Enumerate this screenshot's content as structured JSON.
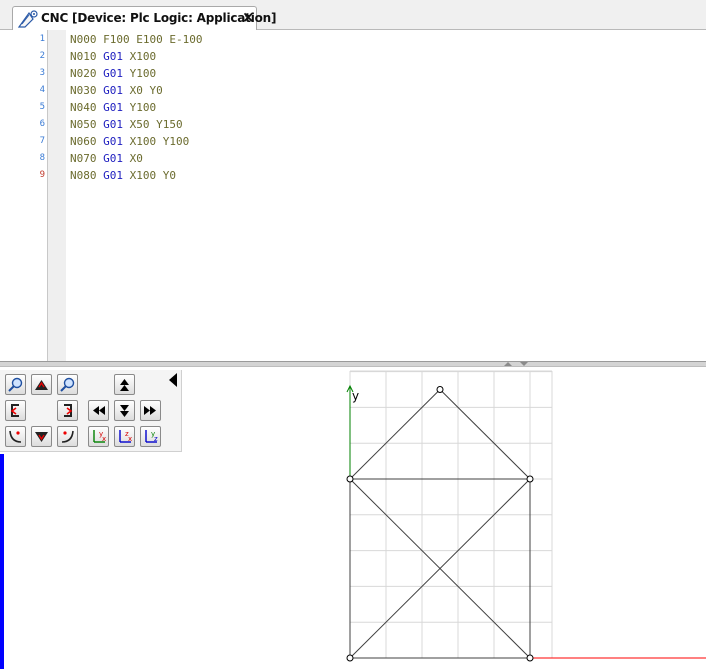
{
  "tab": {
    "title": "CNC [Device: Plc Logic: Application]",
    "close_label": "×",
    "icon": "cnc-gear-icon"
  },
  "editor": {
    "lines": [
      {
        "num": "1",
        "tokens": [
          {
            "t": "N000",
            "c": "n"
          },
          {
            "t": " "
          },
          {
            "t": "F100",
            "c": "v"
          },
          {
            "t": " "
          },
          {
            "t": "E100",
            "c": "v"
          },
          {
            "t": " "
          },
          {
            "t": "E-100",
            "c": "v"
          }
        ]
      },
      {
        "num": "2",
        "tokens": [
          {
            "t": "N010",
            "c": "n"
          },
          {
            "t": " "
          },
          {
            "t": "G01",
            "c": "g"
          },
          {
            "t": " "
          },
          {
            "t": "X100",
            "c": "v"
          }
        ]
      },
      {
        "num": "3",
        "tokens": [
          {
            "t": "N020",
            "c": "n"
          },
          {
            "t": " "
          },
          {
            "t": "G01",
            "c": "g"
          },
          {
            "t": " "
          },
          {
            "t": "Y100",
            "c": "v"
          }
        ]
      },
      {
        "num": "4",
        "tokens": [
          {
            "t": "N030",
            "c": "n"
          },
          {
            "t": " "
          },
          {
            "t": "G01",
            "c": "g"
          },
          {
            "t": " "
          },
          {
            "t": "X0",
            "c": "v"
          },
          {
            "t": " "
          },
          {
            "t": "Y0",
            "c": "v"
          }
        ]
      },
      {
        "num": "5",
        "tokens": [
          {
            "t": "N040",
            "c": "n"
          },
          {
            "t": " "
          },
          {
            "t": "G01",
            "c": "g"
          },
          {
            "t": " "
          },
          {
            "t": "Y100",
            "c": "v"
          }
        ]
      },
      {
        "num": "6",
        "tokens": [
          {
            "t": "N050",
            "c": "n"
          },
          {
            "t": " "
          },
          {
            "t": "G01",
            "c": "g"
          },
          {
            "t": " "
          },
          {
            "t": "X50",
            "c": "v"
          },
          {
            "t": " "
          },
          {
            "t": "Y150",
            "c": "v"
          }
        ]
      },
      {
        "num": "7",
        "tokens": [
          {
            "t": "N060",
            "c": "n"
          },
          {
            "t": " "
          },
          {
            "t": "G01",
            "c": "g"
          },
          {
            "t": " "
          },
          {
            "t": "X100",
            "c": "v"
          },
          {
            "t": " "
          },
          {
            "t": "Y100",
            "c": "v"
          }
        ]
      },
      {
        "num": "8",
        "tokens": [
          {
            "t": "N070",
            "c": "n"
          },
          {
            "t": " "
          },
          {
            "t": "G01",
            "c": "g"
          },
          {
            "t": " "
          },
          {
            "t": "X0",
            "c": "v"
          }
        ]
      },
      {
        "num": "9",
        "tokens": [
          {
            "t": "N080",
            "c": "n"
          },
          {
            "t": " "
          },
          {
            "t": "G01",
            "c": "g"
          },
          {
            "t": " "
          },
          {
            "t": "X100",
            "c": "v"
          },
          {
            "t": " "
          },
          {
            "t": "Y0",
            "c": "v"
          }
        ]
      }
    ]
  },
  "toolbar": {
    "buttons": [
      {
        "name": "zoom-in-button",
        "icon": "magnifier-icon"
      },
      {
        "name": "pan-up-button",
        "icon": "arrow-up-mountain-icon"
      },
      {
        "name": "zoom-out-button",
        "icon": "magnifier-icon"
      },
      {
        "name": "step-up-button",
        "icon": "double-up-arrow-icon"
      },
      {
        "name": "rotate-left-button",
        "icon": "rotate-left-icon"
      },
      {
        "name": "rotate-right-button",
        "icon": "rotate-right-icon"
      },
      {
        "name": "step-back-button",
        "icon": "skip-back-icon"
      },
      {
        "name": "step-down-button",
        "icon": "double-down-arrow-icon"
      },
      {
        "name": "step-forward-button",
        "icon": "skip-forward-icon"
      },
      {
        "name": "curve-left-button",
        "icon": "curve-left-icon"
      },
      {
        "name": "pan-down-button",
        "icon": "arrow-down-mountain-icon"
      },
      {
        "name": "curve-right-button",
        "icon": "curve-right-icon"
      },
      {
        "name": "view-xy-button",
        "icon": "axes-xy-icon"
      },
      {
        "name": "view-yx-button",
        "icon": "axes-yx-icon"
      },
      {
        "name": "view-yz-button",
        "icon": "axes-yz-icon"
      }
    ],
    "colors": {
      "axes_red": "#d40000",
      "axes_green": "#008000",
      "axes_blue": "#0000cc"
    }
  },
  "plot": {
    "y_axis_label": "y",
    "path_points": [
      [
        0,
        0
      ],
      [
        100,
        0
      ],
      [
        100,
        100
      ],
      [
        0,
        0
      ],
      [
        0,
        100
      ],
      [
        50,
        150
      ],
      [
        100,
        100
      ],
      [
        0,
        100
      ],
      [
        100,
        0
      ]
    ],
    "grid_step": 20,
    "x_range": [
      0,
      110
    ],
    "y_range": [
      0,
      160
    ],
    "colors": {
      "path": "#404040",
      "x_axis": "#ff0000",
      "y_axis": "#008000",
      "grid": "#d8d8d8"
    }
  }
}
